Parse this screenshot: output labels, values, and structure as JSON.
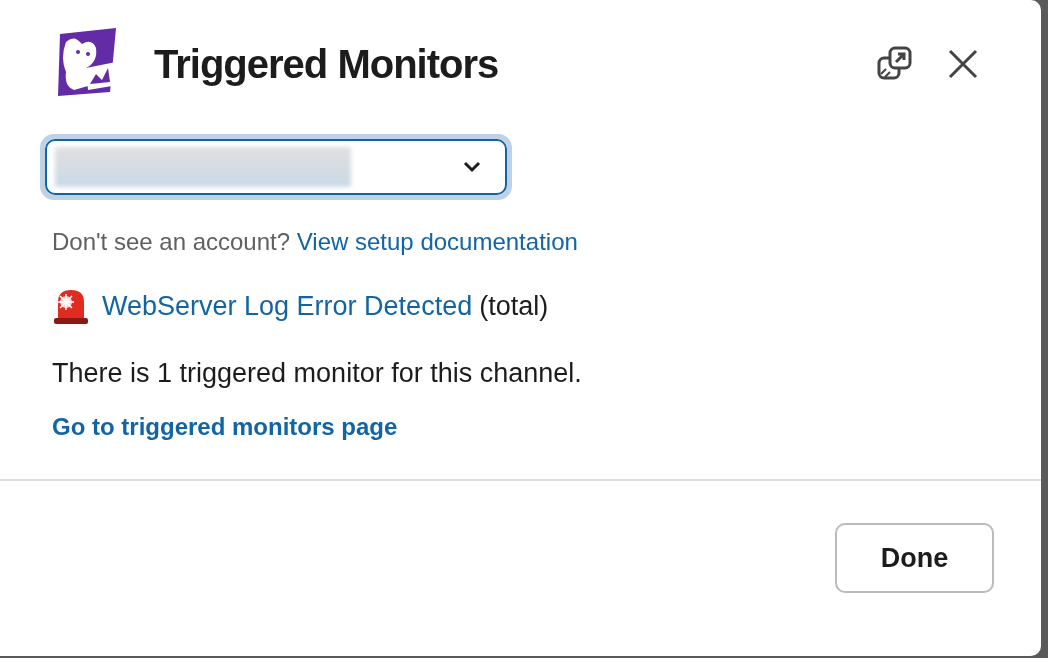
{
  "modal": {
    "title": "Triggered Monitors",
    "account_select": {
      "expanded": false
    },
    "account_hint": {
      "text": "Don't see an account?",
      "link": "View setup documentation"
    },
    "monitors": [
      {
        "name": "WebServer Log Error Detected",
        "suffix": "(total)"
      }
    ],
    "summary": "There is 1 triggered monitor for this channel.",
    "page_link": "Go to triggered monitors page",
    "buttons": [
      "Done"
    ]
  }
}
